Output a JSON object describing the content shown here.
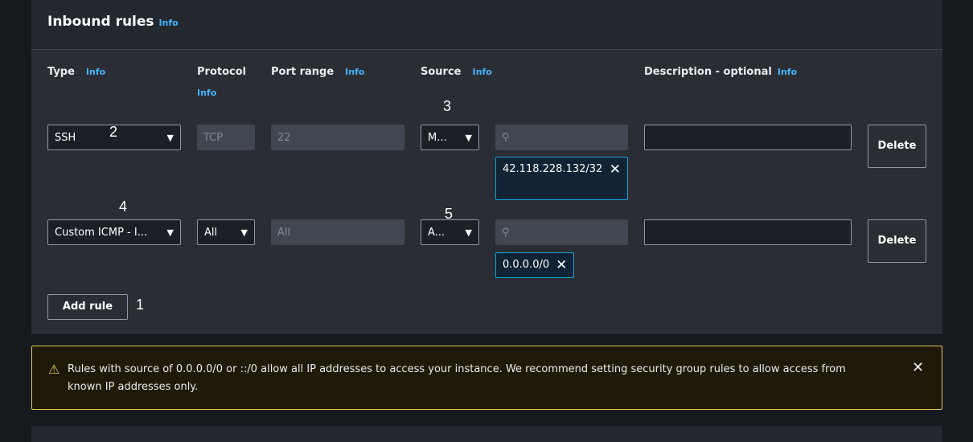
{
  "section": {
    "title": "Inbound rules",
    "info": "Info"
  },
  "columns": {
    "type": {
      "label": "Type",
      "info": "Info"
    },
    "protocol": {
      "label": "Protocol",
      "info": "Info"
    },
    "port_range": {
      "label": "Port range",
      "info": "Info"
    },
    "source": {
      "label": "Source",
      "info": "Info"
    },
    "description": {
      "label": "Description - optional",
      "info": "Info"
    }
  },
  "rules": [
    {
      "type": "SSH",
      "protocol": "TCP",
      "port_range": "22",
      "source": "M...",
      "search_placeholder": "",
      "cidr": "42.118.228.132/32",
      "description": "",
      "delete": "Delete"
    },
    {
      "type": "Custom ICMP - I...",
      "protocol": "All",
      "port_range": "All",
      "source": "A...",
      "search_placeholder": "",
      "cidr": "0.0.0.0/0",
      "description": "",
      "delete": "Delete"
    }
  ],
  "add_rule": "Add rule",
  "annotations": [
    "1",
    "2",
    "3",
    "4",
    "5"
  ],
  "warning": {
    "text": "Rules with source of 0.0.0.0/0 or ::/0 allow all IP addresses to access your instance. We recommend setting security group rules to allow access from known IP addresses only.",
    "icon": "warning-icon",
    "close": "close-icon"
  },
  "colors": {
    "info_link": "#42b4ff",
    "token_border": "#0fa3d8",
    "warning_border": "#e0ca57"
  }
}
